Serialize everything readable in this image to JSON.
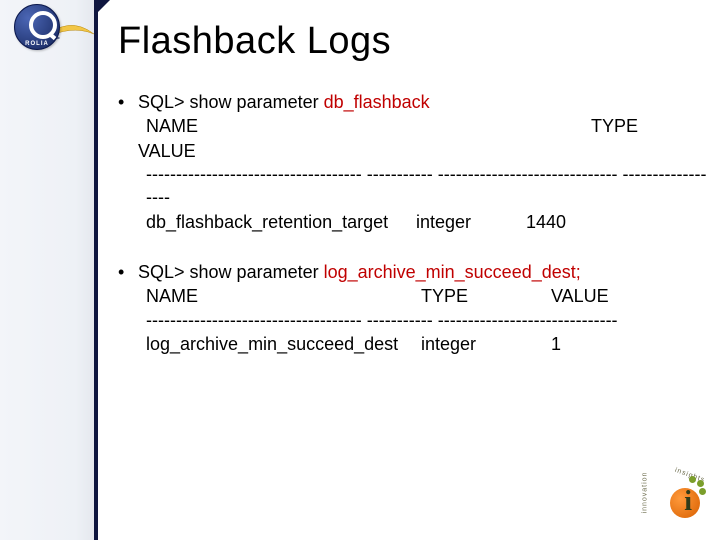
{
  "title": "Flashback Logs",
  "block1": {
    "prompt": "SQL> show parameter ",
    "param": "db_flashback",
    "hdr_name": "NAME",
    "hdr_type": "TYPE",
    "hdr_value": "VALUE",
    "sep": "------------------------------------ ----------- ------------------------------ ------------------",
    "row_name": "db_flashback_retention_target",
    "row_type": "integer",
    "row_value": "1440"
  },
  "block2": {
    "prompt": "SQL> show parameter ",
    "param": "log_archive_min_succeed_dest;",
    "hdr_name": "NAME",
    "hdr_type": "TYPE",
    "hdr_value": "VALUE",
    "sep": "------------------------------------ ----------- ------------------------------",
    "row_name": "log_archive_min_succeed_dest",
    "row_type": "integer",
    "row_value": "1"
  },
  "logo": {
    "badge_text": "ROLIA"
  }
}
